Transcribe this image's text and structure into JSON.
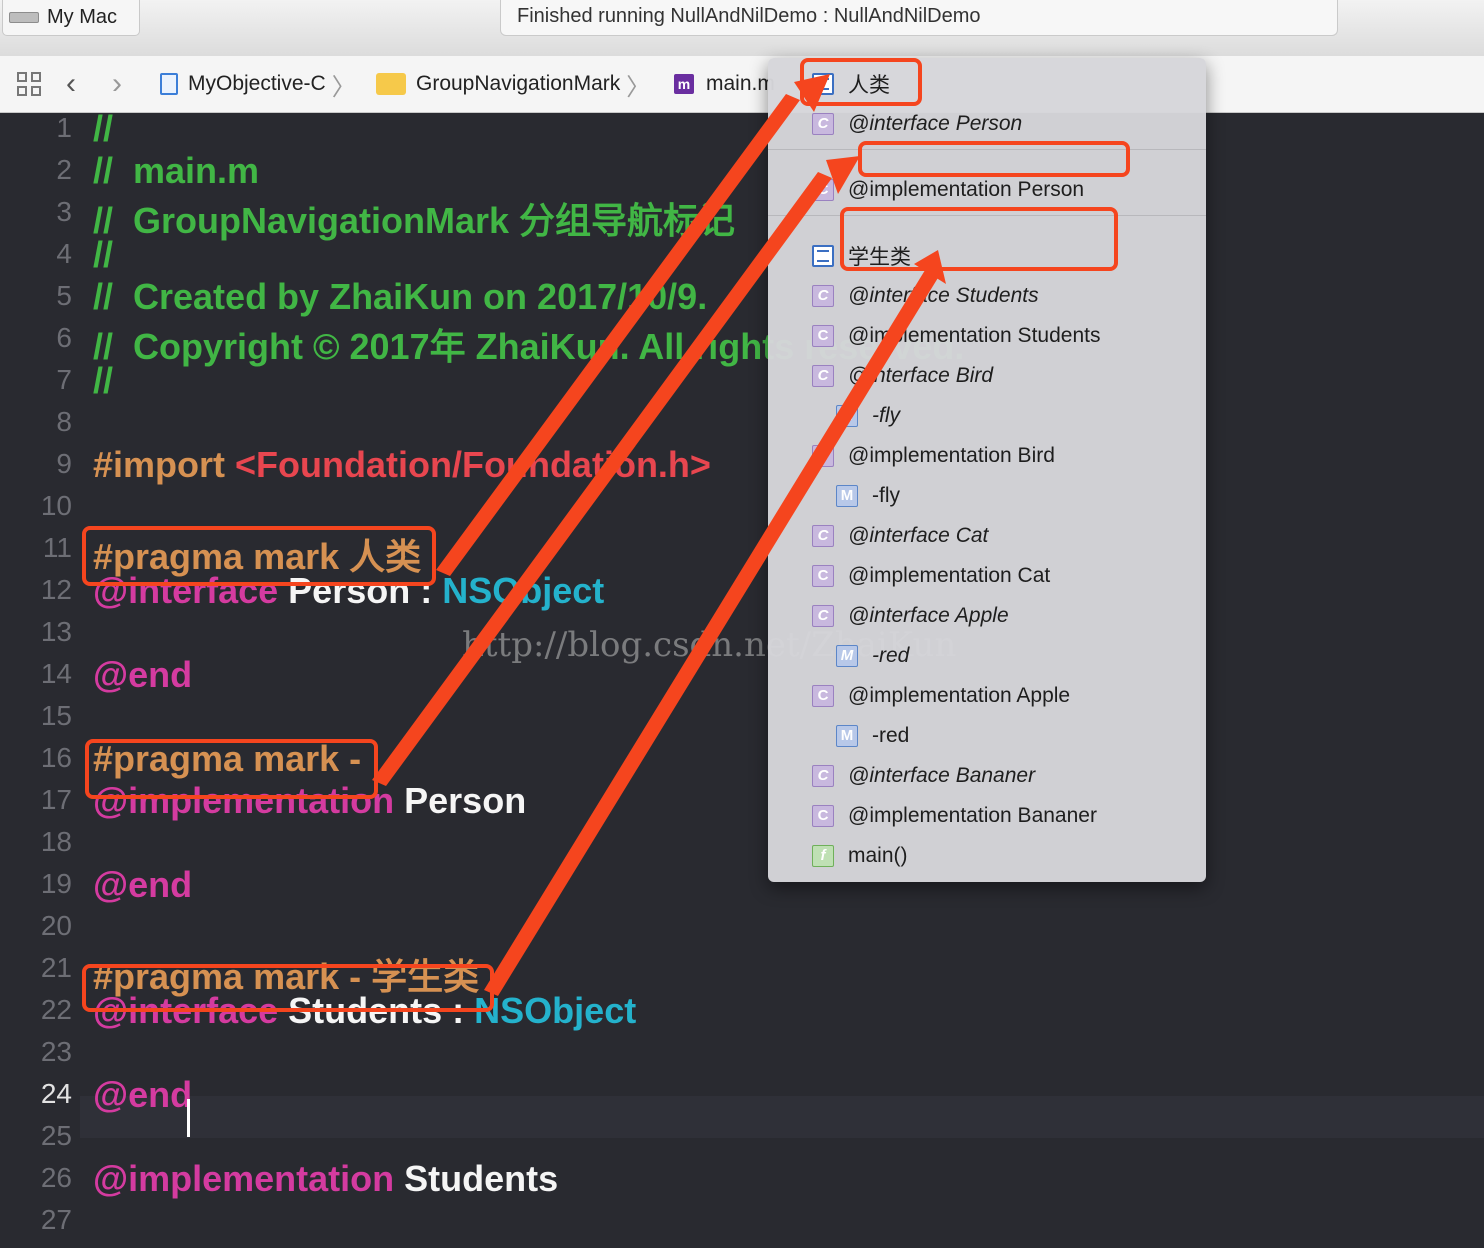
{
  "topbar": {
    "scheme_label": "My Mac",
    "status_text": "Finished running NullAndNilDemo : NullAndNilDemo"
  },
  "jumpbar": {
    "crumbs": [
      "MyObjective-C",
      "GroupNavigationMark",
      "main.m"
    ],
    "file_badge": "m"
  },
  "editor": {
    "lines": [
      {
        "n": "1",
        "parts": [
          {
            "t": "//",
            "c": "cm"
          }
        ]
      },
      {
        "n": "2",
        "parts": [
          {
            "t": "//  main.m",
            "c": "cm"
          }
        ]
      },
      {
        "n": "3",
        "parts": [
          {
            "t": "//  GroupNavigationMark 分组导航标记",
            "c": "cm"
          }
        ]
      },
      {
        "n": "4",
        "parts": [
          {
            "t": "//",
            "c": "cm"
          }
        ]
      },
      {
        "n": "5",
        "parts": [
          {
            "t": "//  Created by ZhaiKun on 2017/10/9.",
            "c": "cm"
          }
        ]
      },
      {
        "n": "6",
        "parts": [
          {
            "t": "//  Copyright © 2017年 ZhaiKun. All rights reserved.",
            "c": "cm"
          }
        ]
      },
      {
        "n": "7",
        "parts": [
          {
            "t": "//",
            "c": "cm"
          }
        ]
      },
      {
        "n": "8",
        "parts": []
      },
      {
        "n": "9",
        "parts": [
          {
            "t": "#import ",
            "c": "pp"
          },
          {
            "t": "<Foundation/Foundation.h>",
            "c": "str"
          }
        ]
      },
      {
        "n": "10",
        "parts": []
      },
      {
        "n": "11",
        "parts": [
          {
            "t": "#pragma mark 人类",
            "c": "pp"
          }
        ]
      },
      {
        "n": "12",
        "parts": [
          {
            "t": "@interface",
            "c": "kw"
          },
          {
            "t": " Person : ",
            "c": "id"
          },
          {
            "t": "NSObject",
            "c": "ty"
          }
        ]
      },
      {
        "n": "13",
        "parts": []
      },
      {
        "n": "14",
        "parts": [
          {
            "t": "@end",
            "c": "kw"
          }
        ]
      },
      {
        "n": "15",
        "parts": []
      },
      {
        "n": "16",
        "parts": [
          {
            "t": "#pragma mark -",
            "c": "pp"
          }
        ]
      },
      {
        "n": "17",
        "parts": [
          {
            "t": "@implementation",
            "c": "kw"
          },
          {
            "t": " Person",
            "c": "id"
          }
        ]
      },
      {
        "n": "18",
        "parts": []
      },
      {
        "n": "19",
        "parts": [
          {
            "t": "@end",
            "c": "kw"
          }
        ]
      },
      {
        "n": "20",
        "parts": []
      },
      {
        "n": "21",
        "parts": [
          {
            "t": "#pragma mark - 学生类",
            "c": "pp"
          }
        ]
      },
      {
        "n": "22",
        "parts": [
          {
            "t": "@interface",
            "c": "kw"
          },
          {
            "t": " Students : ",
            "c": "id"
          },
          {
            "t": "NSObject",
            "c": "ty"
          }
        ]
      },
      {
        "n": "23",
        "parts": []
      },
      {
        "n": "24",
        "parts": [
          {
            "t": "@end",
            "c": "kw"
          }
        ]
      },
      {
        "n": "25",
        "parts": []
      },
      {
        "n": "26",
        "parts": [
          {
            "t": "@implementation",
            "c": "kw"
          },
          {
            "t": " Students",
            "c": "id"
          }
        ]
      },
      {
        "n": "27",
        "parts": []
      }
    ],
    "current_line": "24",
    "watermark": "http://blog.csdn.net/ZhaiKun"
  },
  "menu": {
    "items": [
      {
        "badge": "mark",
        "label": "人类",
        "italic": false,
        "indent": false
      },
      {
        "badge": "C",
        "label": "@interface Person",
        "italic": true,
        "indent": false
      },
      {
        "sep": true
      },
      {
        "badge": "C",
        "label": "@implementation Person",
        "italic": false,
        "indent": false
      },
      {
        "sep": true
      },
      {
        "badge": "mark",
        "label": "学生类",
        "italic": false,
        "indent": false
      },
      {
        "badge": "C",
        "label": "@interface Students",
        "italic": true,
        "indent": false
      },
      {
        "badge": "C",
        "label": "@implementation Students",
        "italic": false,
        "indent": false
      },
      {
        "badge": "C",
        "label": "@interface Bird",
        "italic": true,
        "indent": false
      },
      {
        "badge": "M",
        "label": "-fly",
        "italic": true,
        "indent": true
      },
      {
        "badge": "C",
        "label": "@implementation Bird",
        "italic": false,
        "indent": false
      },
      {
        "badge": "M",
        "label": "-fly",
        "italic": false,
        "indent": true
      },
      {
        "badge": "C",
        "label": "@interface Cat",
        "italic": true,
        "indent": false
      },
      {
        "badge": "C",
        "label": "@implementation Cat",
        "italic": false,
        "indent": false
      },
      {
        "badge": "C",
        "label": "@interface Apple",
        "italic": true,
        "indent": false
      },
      {
        "badge": "M",
        "label": "-red",
        "italic": true,
        "indent": true
      },
      {
        "badge": "C",
        "label": "@implementation Apple",
        "italic": false,
        "indent": false
      },
      {
        "badge": "M",
        "label": "-red",
        "italic": false,
        "indent": true
      },
      {
        "badge": "C",
        "label": "@interface Bananer",
        "italic": true,
        "indent": false
      },
      {
        "badge": "C",
        "label": "@implementation Bananer",
        "italic": false,
        "indent": false
      },
      {
        "badge": "f",
        "label": "main()",
        "italic": false,
        "indent": false
      }
    ]
  },
  "colors": {
    "annotation": "#f5451e",
    "comment": "#41b645",
    "keyword": "#d43ba0",
    "preprocessor": "#d69152",
    "string": "#e8464f",
    "type": "#24b2cc"
  }
}
